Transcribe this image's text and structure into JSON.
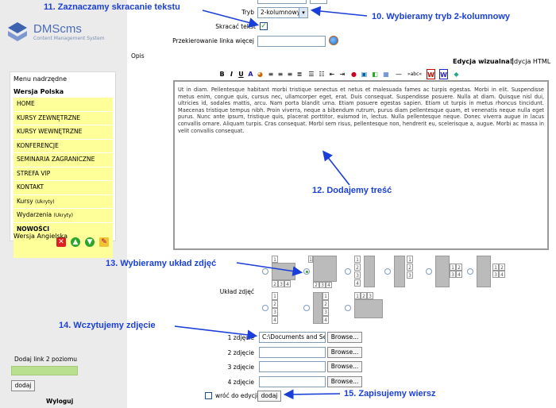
{
  "logo": {
    "name": "DMScms",
    "tagline": "Content Management System"
  },
  "sidebar": {
    "menu_parent": "Menu nadrzędne",
    "version_pl": "Wersja Polska",
    "items": [
      {
        "label": "HOME",
        "extra": ""
      },
      {
        "label": "KURSY ZEWNĘTRZNE",
        "extra": ""
      },
      {
        "label": "KURSY WEWNĘTRZNE",
        "extra": ""
      },
      {
        "label": "KONFERENCJE",
        "extra": ""
      },
      {
        "label": "SEMINARIA ZAGRANICZNE",
        "extra": ""
      },
      {
        "label": "STREFA VIP",
        "extra": ""
      },
      {
        "label": "KONTAKT",
        "extra": ""
      },
      {
        "label": "Kursy",
        "extra": "(Ukryty)"
      },
      {
        "label": "Wydarzenia",
        "extra": "(Ukryty)"
      }
    ],
    "new_item": "NOWOŚCI",
    "version_en": "Wersja Angielska",
    "add_level": "Dodaj link 2 poziomu",
    "add_button": "dodaj",
    "logout": "Wyloguj"
  },
  "form": {
    "mode_label": "Tryb",
    "mode_value": "2-kolumnowy",
    "shorten_label": "Skracać tekst",
    "redirect_label": "Przekierowanie linka więcej",
    "description_label": "Opis",
    "tab_visual": "Edycja wizualna",
    "tab_html": "Edycja HTML",
    "toolbar": {
      "bold": "B",
      "italic": "I",
      "underline": "U",
      "abc": "»abc«"
    },
    "editor_text": "Ut in diam. Pellentesque habitant morbi tristique senectus et netus et malesuada fames ac turpis egestas. Morbi in elit. Suspendisse metus enim, congue quis, cursus nec, ullamcorper eget, erat. Duis consequat. Suspendisse posuere. Nulla at diam. Quisque nisl dui, ultricies id, sodales mattis, arcu. Nam porta blandit urna. Etiam posuere egestas sapien. Etiam ut turpis in metus rhoncus tincidunt. Maecenas tristique tempus nibh. Proin viverra, neque a bibendum rutrum, purus diam pellentesque quam, et venenatis neque nulla eget purus. Nunc ante ipsum, tristique quis, placerat porttitor, euismod in, lectus. Nulla pellentesque neque. Donec viverra augue in lacus convallis ornare. Aliquam turpis. Cras consequat. Morbi sem risus, pellentesque non, hendrerit eu, scelerisque a, augue. Morbi ac massa in velit convallis consequat.",
    "layout_label": "Układ zdjęć",
    "photos": [
      {
        "label": "1 zdjęcie",
        "value": "C:\\Documents and Se"
      },
      {
        "label": "2 zdjęcie",
        "value": ""
      },
      {
        "label": "3 zdjęcie",
        "value": ""
      },
      {
        "label": "4 zdjęcie",
        "value": ""
      }
    ],
    "browse": "Browse...",
    "return_label": "wróć do edycji",
    "submit": "dodaj"
  },
  "annotations": {
    "a10": "10. Wybieramy tryb 2-kolumnowy",
    "a11": "11. Zaznaczamy skracanie tekstu",
    "a12": "12. Dodajemy treść",
    "a13": "13. Wybieramy układ zdjęć",
    "a14": "14. Wczytujemy zdjęcie",
    "a15": "15. Zapisujemy wiersz"
  },
  "colors": {
    "annotation": "#1a3fd9",
    "menu_item_bg": "#ffff99",
    "sidebar_bg": "#ebebeb"
  }
}
